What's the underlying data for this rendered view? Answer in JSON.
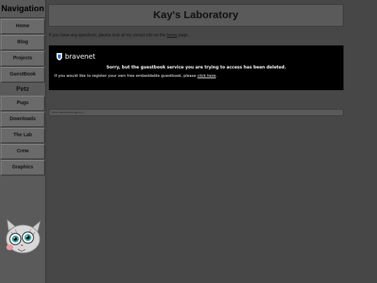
{
  "sidebar": {
    "title": "Navigation",
    "items": [
      {
        "label": "Home"
      },
      {
        "label": "Blog"
      },
      {
        "label": "Projects"
      },
      {
        "label": "GuestBook"
      }
    ],
    "section_label": "Petz",
    "section_items": [
      {
        "label": "Pugs"
      },
      {
        "label": "Downloads"
      },
      {
        "label": "The Lab"
      },
      {
        "label": "Crew"
      },
      {
        "label": "Graphics"
      }
    ]
  },
  "header": {
    "title": "Kay's Laboratory"
  },
  "contact": {
    "text_before": "If you have any questions, please look at my conact info on the ",
    "link": "home",
    "text_after": " page."
  },
  "guestbook": {
    "brand": "bravenet",
    "error": "Sorry, but the guestbook service you are trying to access has been deleted.",
    "register_text": "If you would like to register your own free embeddable guestbook, please ",
    "register_link": "click here",
    "register_end": "."
  },
  "footer": {
    "text": "Most content belongs to K."
  }
}
